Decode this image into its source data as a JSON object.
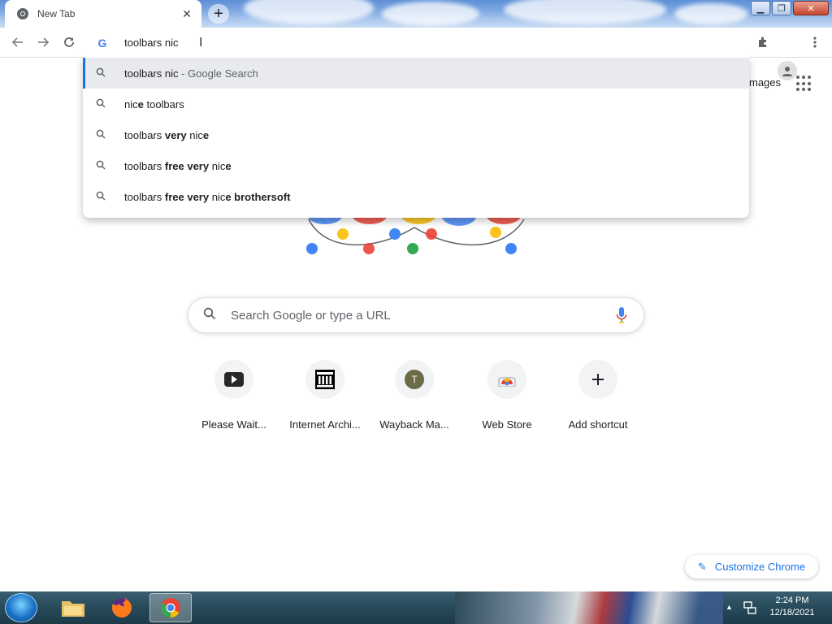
{
  "browser": {
    "tab_title": "New Tab",
    "new_tab_label": "+"
  },
  "omnibox": {
    "text": "toolbars nic"
  },
  "suggestions": [
    {
      "parts": [
        {
          "t": "toolbars nic",
          "b": false
        },
        {
          "t": " - Google Search",
          "muted": true
        }
      ]
    },
    {
      "parts": [
        {
          "t": "nic",
          "b": false
        },
        {
          "t": "e",
          "b": true
        },
        {
          "t": " toolbars",
          "b": false
        }
      ]
    },
    {
      "parts": [
        {
          "t": "toolbars ",
          "b": false
        },
        {
          "t": "very",
          "b": true
        },
        {
          "t": " nic",
          "b": false
        },
        {
          "t": "e",
          "b": true
        }
      ]
    },
    {
      "parts": [
        {
          "t": "toolbars ",
          "b": false
        },
        {
          "t": "free very",
          "b": true
        },
        {
          "t": " nic",
          "b": false
        },
        {
          "t": "e",
          "b": true
        }
      ]
    },
    {
      "parts": [
        {
          "t": "toolbars ",
          "b": false
        },
        {
          "t": "free very",
          "b": true
        },
        {
          "t": " nic",
          "b": false
        },
        {
          "t": "e brothersoft",
          "b": true
        }
      ]
    }
  ],
  "ntp": {
    "images_link": "mages",
    "search_placeholder": "Search Google or type a URL",
    "shortcuts": [
      {
        "label": "Please Wait...",
        "icon": "youtube-icon"
      },
      {
        "label": "Internet Archi...",
        "icon": "archive-icon"
      },
      {
        "label": "Wayback Ma...",
        "icon": "letter-t-icon",
        "letter": "T"
      },
      {
        "label": "Web Store",
        "icon": "webstore-icon"
      },
      {
        "label": "Add shortcut",
        "icon": "plus-icon"
      }
    ],
    "customize_label": "Customize Chrome"
  },
  "taskbar": {
    "time": "2:24 PM",
    "date": "12/18/2021"
  },
  "colors": {
    "accent": "#1a73e8",
    "selected_row": "#e8eaed"
  }
}
